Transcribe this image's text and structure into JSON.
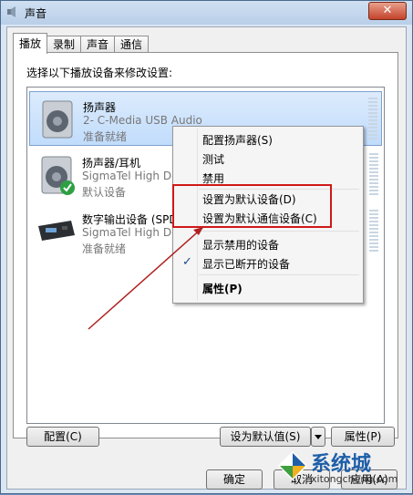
{
  "window": {
    "title": "声音",
    "close_glyph": "✕"
  },
  "tabs": [
    "播放",
    "录制",
    "声音",
    "通信"
  ],
  "instruction": "选择以下播放设备来修改设置:",
  "devices": [
    {
      "name": "扬声器",
      "desc": "2- C-Media USB Audio",
      "status": "准备就绪",
      "icon": "speaker-icon"
    },
    {
      "name": "扬声器/耳机",
      "desc": "SigmaTel High De",
      "status": "默认设备",
      "icon": "speaker-default-icon"
    },
    {
      "name": "数字输出设备 (SPD",
      "desc": "SigmaTel High De",
      "status": "准备就绪",
      "icon": "digital-output-icon"
    }
  ],
  "context_menu": {
    "items": [
      "配置扬声器(S)",
      "测试",
      "禁用",
      "设置为默认设备(D)",
      "设置为默认通信设备(C)",
      "显示禁用的设备",
      "显示已断开的设备",
      "属性(P)"
    ],
    "checkmark": "✓"
  },
  "buttons": {
    "configure": "配置(C)",
    "set_default": "设为默认值(S)",
    "properties": "属性(P)",
    "ok": "确定",
    "cancel": "取消",
    "apply": "应用(A)"
  },
  "watermark": {
    "text": "系统城",
    "url": "xitongcheng.com"
  },
  "colors": {
    "highlight_box": "#d01818",
    "selection": "#c1dcfc",
    "arrow": "#b02020"
  }
}
